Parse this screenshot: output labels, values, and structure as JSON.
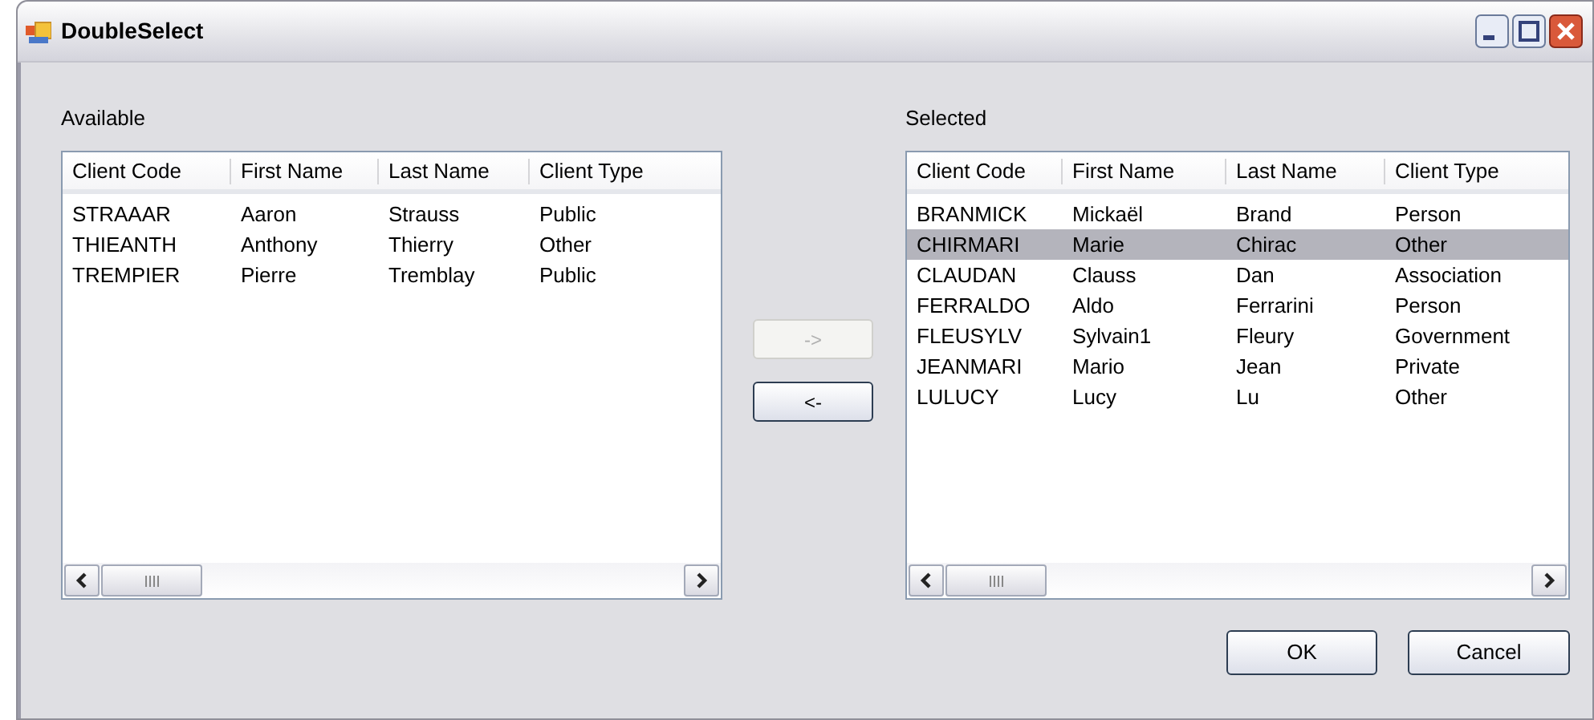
{
  "window": {
    "title": "DoubleSelect"
  },
  "lists": [
    {
      "label": "Available",
      "columns": [
        "Client Code",
        "First Name",
        "Last Name",
        "Client Type"
      ],
      "rows": [
        {
          "cells": [
            "STRAAAR",
            "Aaron",
            "Strauss",
            "Public"
          ],
          "selected": false
        },
        {
          "cells": [
            "THIEANTH",
            "Anthony",
            "Thierry",
            "Other"
          ],
          "selected": false
        },
        {
          "cells": [
            "TREMPIER",
            "Pierre",
            "Tremblay",
            "Public"
          ],
          "selected": false
        }
      ]
    },
    {
      "label": "Selected",
      "columns": [
        "Client Code",
        "First Name",
        "Last Name",
        "Client Type"
      ],
      "rows": [
        {
          "cells": [
            "BRANMICK",
            "Mickaël",
            "Brand",
            "Person"
          ],
          "selected": false
        },
        {
          "cells": [
            "CHIRMARI",
            "Marie",
            "Chirac",
            "Other"
          ],
          "selected": true
        },
        {
          "cells": [
            "CLAUDAN",
            "Clauss",
            "Dan",
            "Association"
          ],
          "selected": false
        },
        {
          "cells": [
            "FERRALDO",
            "Aldo",
            "Ferrarini",
            "Person"
          ],
          "selected": false
        },
        {
          "cells": [
            "FLEUSYLV",
            "Sylvain1",
            "Fleury",
            "Government"
          ],
          "selected": false
        },
        {
          "cells": [
            "JEANMARI",
            "Mario",
            "Jean",
            "Private"
          ],
          "selected": false
        },
        {
          "cells": [
            "LULUCY",
            "Lucy",
            "Lu",
            "Other"
          ],
          "selected": false
        }
      ]
    }
  ],
  "move_buttons": [
    {
      "label": "->",
      "disabled": true
    },
    {
      "label": "<-",
      "disabled": false
    }
  ],
  "dialog_buttons": [
    {
      "label": "OK"
    },
    {
      "label": "Cancel"
    }
  ]
}
